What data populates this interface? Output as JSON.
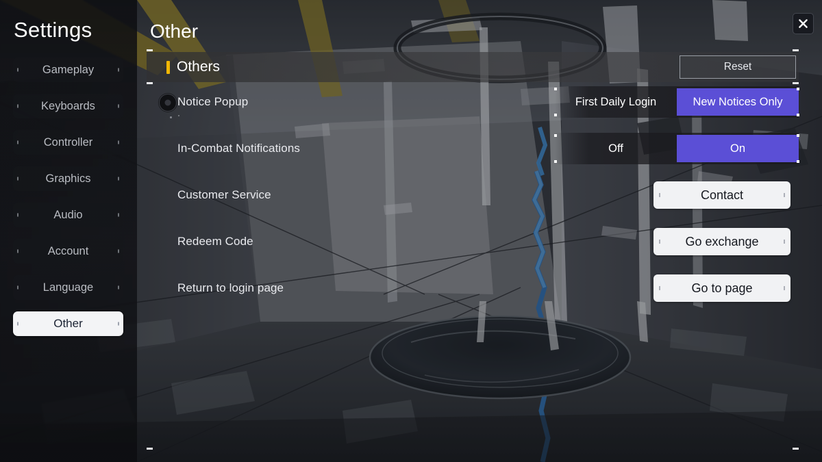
{
  "window": {
    "close_icon": "close-icon"
  },
  "sidebar": {
    "title": "Settings",
    "items": [
      {
        "label": "Gameplay",
        "active": false
      },
      {
        "label": "Keyboards",
        "active": false
      },
      {
        "label": "Controller",
        "active": false
      },
      {
        "label": "Graphics",
        "active": false
      },
      {
        "label": "Audio",
        "active": false
      },
      {
        "label": "Account",
        "active": false
      },
      {
        "label": "Language",
        "active": false
      },
      {
        "label": "Other",
        "active": true
      }
    ]
  },
  "content": {
    "page_title": "Other",
    "section": {
      "title": "Others",
      "accent_color": "#f2b705",
      "reset_label": "Reset"
    },
    "rows": [
      {
        "label": "Notice Popup",
        "type": "segmented",
        "options": [
          "First Daily Login",
          "New Notices Only"
        ],
        "selected": "New Notices Only"
      },
      {
        "label": "In-Combat Notifications",
        "type": "segmented",
        "options": [
          "Off",
          "On"
        ],
        "selected": "On"
      },
      {
        "label": "Customer Service",
        "type": "button",
        "button_label": "Contact"
      },
      {
        "label": "Redeem Code",
        "type": "button",
        "button_label": "Go exchange"
      },
      {
        "label": "Return to login page",
        "type": "button",
        "button_label": "Go to page"
      }
    ]
  },
  "colors": {
    "accent_yellow": "#f2b705",
    "toggle_active_purple": "#5b4fd6",
    "button_light": "#f1f2f4",
    "text_primary": "#ffffff",
    "text_muted": "#b9bcc2"
  }
}
